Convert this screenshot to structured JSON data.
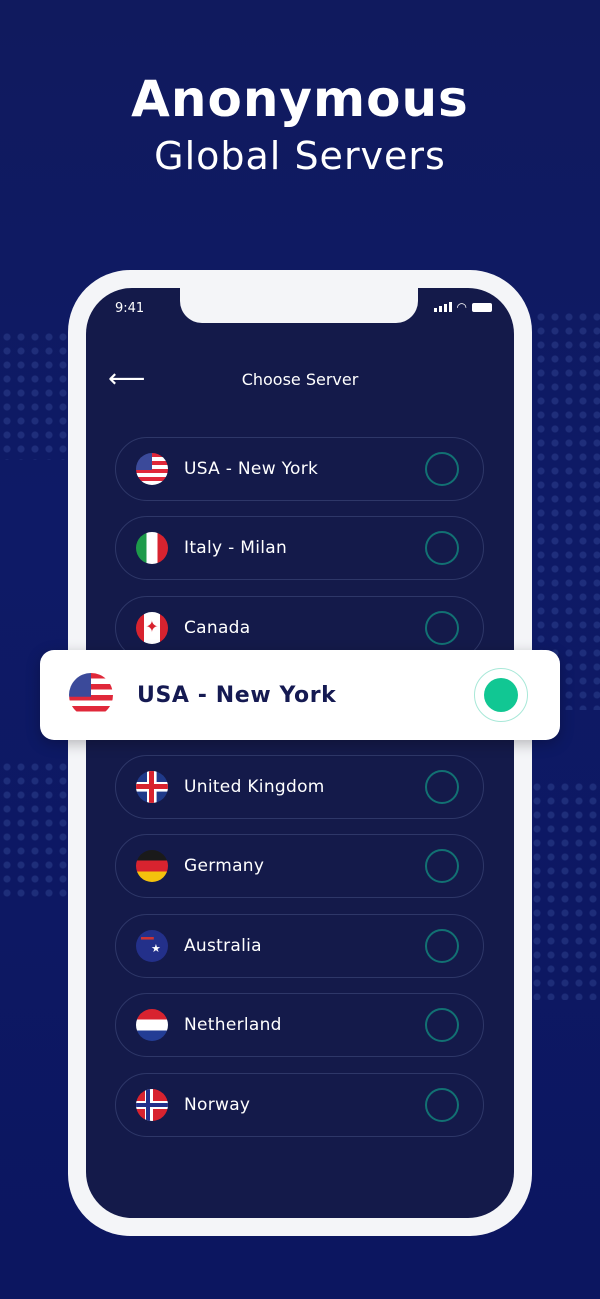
{
  "headline": {
    "title": "Anonymous",
    "subtitle": "Global Servers"
  },
  "status_bar": {
    "time": "9:41"
  },
  "header": {
    "title": "Choose Server",
    "back_icon": "arrow-left-icon"
  },
  "servers": [
    {
      "label": "USA - New York",
      "flag": "usa",
      "selected": false
    },
    {
      "label": "Italy - Milan",
      "flag": "it",
      "selected": false
    },
    {
      "label": "Canada",
      "flag": "ca",
      "selected": false
    },
    {
      "label": "United Kingdom",
      "flag": "uk",
      "selected": false
    },
    {
      "label": "Germany",
      "flag": "de",
      "selected": false
    },
    {
      "label": "Australia",
      "flag": "au",
      "selected": false
    },
    {
      "label": "Netherland",
      "flag": "nl",
      "selected": false
    },
    {
      "label": "Norway",
      "flag": "no",
      "selected": false
    }
  ],
  "selected_server": {
    "label": "USA - New York",
    "flag": "usa"
  },
  "colors": {
    "accent": "#11c793",
    "background": "#101a5e",
    "screen": "#141a4a",
    "ring": "#127173"
  }
}
